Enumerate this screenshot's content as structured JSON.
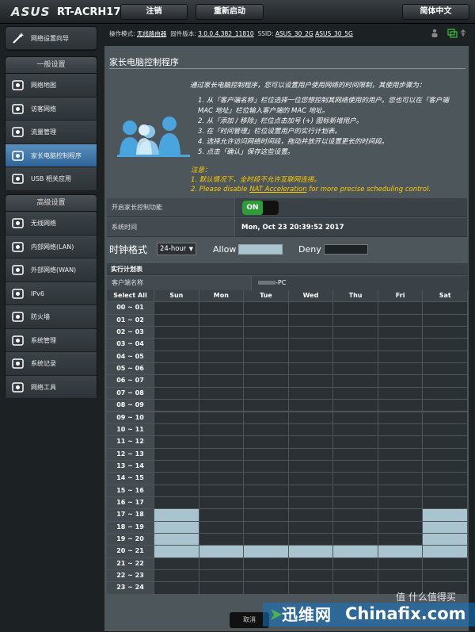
{
  "header": {
    "logo": "ASUS",
    "model": "RT-ACRH17",
    "logout": "注销",
    "reboot": "重新启动",
    "language": "简体中文"
  },
  "status": {
    "mode_label": "操作模式:",
    "mode_value": "无线路由器",
    "firmware_label": "固件版本:",
    "firmware_value": "3.0.0.4.382_11810",
    "ssid_label": "SSID:",
    "ssid_2g": "ASUS_30_2G",
    "ssid_5g": "ASUS_30_5G"
  },
  "sidebar": {
    "wizard": "网络设置向导",
    "general_header": "一般设置",
    "general_items": [
      {
        "label": "网络地图",
        "icon": "network-map-icon"
      },
      {
        "label": "访客网络",
        "icon": "guest-network-icon"
      },
      {
        "label": "流量管理",
        "icon": "traffic-manager-icon"
      },
      {
        "label": "家长电脑控制程序",
        "icon": "parental-control-icon"
      },
      {
        "label": "USB 相关应用",
        "icon": "usb-app-icon"
      }
    ],
    "advanced_header": "高级设置",
    "advanced_items": [
      {
        "label": "无线网络",
        "icon": "wireless-icon"
      },
      {
        "label": "内部网络(LAN)",
        "icon": "lan-icon"
      },
      {
        "label": "外部网络(WAN)",
        "icon": "wan-icon"
      },
      {
        "label": "IPv6",
        "icon": "ipv6-icon"
      },
      {
        "label": "防火墙",
        "icon": "firewall-icon"
      },
      {
        "label": "系统管理",
        "icon": "administration-icon"
      },
      {
        "label": "系统记录",
        "icon": "system-log-icon"
      },
      {
        "label": "网络工具",
        "icon": "network-tools-icon"
      }
    ]
  },
  "page": {
    "title": "家长电脑控制程序",
    "intro": "通过家长电脑控制程序，您可以设置用户使用网络的时间限制，其使用步骤为：",
    "steps": [
      "1. 从「客户端名称」栏位选择一位您想控制其网络使用的用户。您也可以在「客户端 MAC 地址」栏位输入客户端的 MAC 地址。",
      "2. 从「添加 / 移除」栏位点击加号 (+) 图标新增用户。",
      "3. 在「时间管理」栏位设置用户的实行计划表。",
      "4. 选择允许访问网络时间段，拖动并放开以设置更长的时间段。",
      "5. 点击「确认」保存这些设置。"
    ],
    "note_title": "注意：",
    "note_1": "1. 默认情况下，全时段不允许互联网连接。",
    "note_2_pre": "2. Please disable ",
    "note_2_link": "NAT Acceleration",
    "note_2_post": " for more precise scheduling control.",
    "enable_label": "开启家长控制功能",
    "enable_value": "ON",
    "time_label": "系统时间",
    "time_value": "Mon, Oct 23 20:39:52 2017",
    "format_label": "时钟格式",
    "format_value": "24-hour",
    "allow_label": "Allow",
    "deny_label": "Deny",
    "schedule_header": "实行计划表",
    "client_label": "客户端名称",
    "client_value": "-PC",
    "cancel": "取消"
  },
  "schedule": {
    "select_all": "Select All",
    "days": [
      "Sun",
      "Mon",
      "Tue",
      "Wed",
      "Thu",
      "Fri",
      "Sat"
    ],
    "hours": [
      "00 ~ 01",
      "01 ~ 02",
      "02 ~ 03",
      "03 ~ 04",
      "04 ~ 05",
      "05 ~ 06",
      "06 ~ 07",
      "07 ~ 08",
      "08 ~ 09",
      "09 ~ 10",
      "10 ~ 11",
      "11 ~ 12",
      "12 ~ 13",
      "13 ~ 14",
      "14 ~ 15",
      "15 ~ 16",
      "16 ~ 17",
      "17 ~ 18",
      "18 ~ 19",
      "19 ~ 20",
      "20 ~ 21",
      "21 ~ 22",
      "22 ~ 23",
      "23 ~ 24"
    ],
    "allowed": [
      [
        17,
        0
      ],
      [
        17,
        6
      ],
      [
        18,
        0
      ],
      [
        18,
        6
      ],
      [
        19,
        0
      ],
      [
        19,
        6
      ],
      [
        20,
        0
      ],
      [
        20,
        1
      ],
      [
        20,
        2
      ],
      [
        20,
        3
      ],
      [
        20,
        4
      ],
      [
        20,
        5
      ],
      [
        20,
        6
      ]
    ],
    "allow_color": "#a9c3cf",
    "deny_color": "#2a3034"
  },
  "watermark": {
    "brand_cn": "迅维网",
    "brand_en": "Chinafix.com",
    "corner": "值 什么值得买"
  }
}
